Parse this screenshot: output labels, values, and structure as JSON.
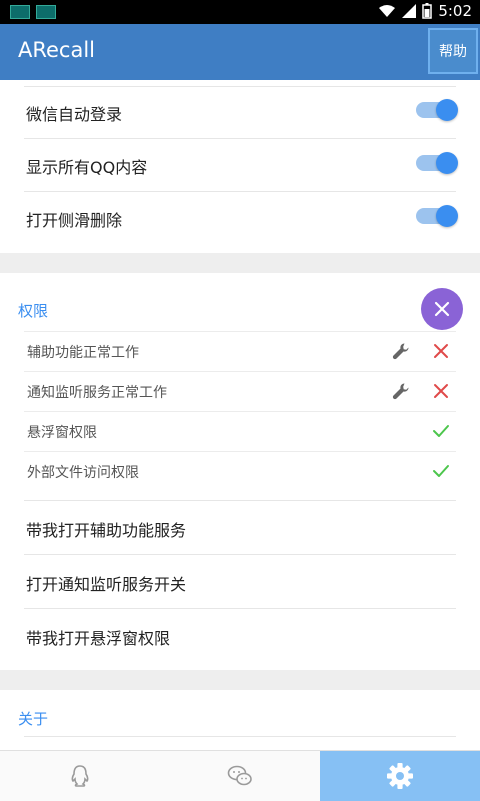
{
  "status_bar": {
    "time": "5:02"
  },
  "app_bar": {
    "title": "ARecall",
    "help_label": "帮助"
  },
  "toggles": [
    {
      "label": "微信自动登录",
      "on": true
    },
    {
      "label": "显示所有QQ内容",
      "on": true
    },
    {
      "label": "打开侧滑删除",
      "on": true
    }
  ],
  "permissions": {
    "title": "权限",
    "items": [
      {
        "label": "辅助功能正常工作",
        "wrench": true,
        "status": "error"
      },
      {
        "label": "通知监听服务正常工作",
        "wrench": true,
        "status": "error"
      },
      {
        "label": "悬浮窗权限",
        "wrench": false,
        "status": "ok"
      },
      {
        "label": "外部文件访问权限",
        "wrench": false,
        "status": "ok"
      }
    ],
    "actions": [
      {
        "label": "带我打开辅助功能服务"
      },
      {
        "label": "打开通知监听服务开关"
      },
      {
        "label": "带我打开悬浮窗权限"
      }
    ]
  },
  "about": {
    "title": "关于"
  },
  "bottom_tabs": [
    {
      "icon": "qq-icon",
      "active": false
    },
    {
      "icon": "wechat-icon",
      "active": false
    },
    {
      "icon": "gear-icon",
      "active": true
    }
  ],
  "colors": {
    "accent": "#3a8ef0",
    "appbar": "#3f7ec4",
    "fab": "#8a63d6",
    "error": "#e04a4a",
    "ok": "#4cc64c"
  }
}
